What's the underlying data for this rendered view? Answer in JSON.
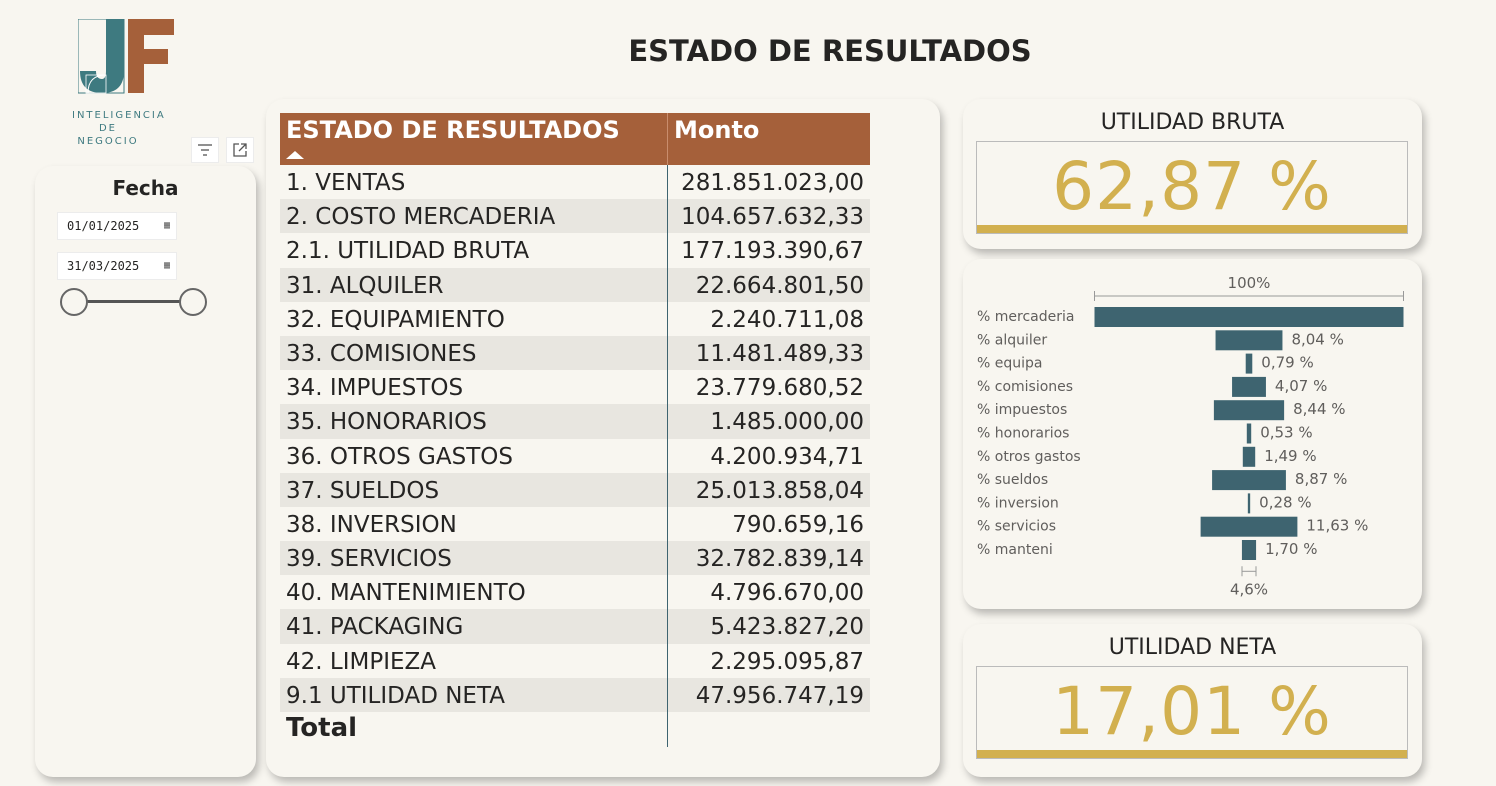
{
  "logo": {
    "letters": "JF",
    "line1": "INTELIGENCIA",
    "line2": "DE NEGOCIO",
    "colors": {
      "teal": "#3e7a80",
      "orange": "#a5603a"
    }
  },
  "page_title": "ESTADO DE RESULTADOS",
  "toolbar": {
    "filter_icon": "filter-icon",
    "focus_icon": "focus-mode-icon"
  },
  "slicer": {
    "title": "Fecha",
    "start_date": "01/01/2025",
    "end_date": "31/03/2025",
    "range": [
      0,
      1
    ]
  },
  "table": {
    "header": {
      "name": "ESTADO DE RESULTADOS",
      "value": "Monto"
    },
    "rows": [
      {
        "name": "1. VENTAS",
        "value": "281.851.023,00"
      },
      {
        "name": "2. COSTO MERCADERIA",
        "value": "104.657.632,33"
      },
      {
        "name": "2.1. UTILIDAD BRUTA",
        "value": "177.193.390,67"
      },
      {
        "name": "31. ALQUILER",
        "value": "22.664.801,50"
      },
      {
        "name": "32. EQUIPAMIENTO",
        "value": "2.240.711,08"
      },
      {
        "name": "33. COMISIONES",
        "value": "11.481.489,33"
      },
      {
        "name": "34. IMPUESTOS",
        "value": "23.779.680,52"
      },
      {
        "name": "35. HONORARIOS",
        "value": "1.485.000,00"
      },
      {
        "name": "36. OTROS GASTOS",
        "value": "4.200.934,71"
      },
      {
        "name": "37. SUELDOS",
        "value": "25.013.858,04"
      },
      {
        "name": "38. INVERSION",
        "value": "790.659,16"
      },
      {
        "name": "39. SERVICIOS",
        "value": "32.782.839,14"
      },
      {
        "name": "40. MANTENIMIENTO",
        "value": "4.796.670,00"
      },
      {
        "name": "41. PACKAGING",
        "value": "5.423.827,20"
      },
      {
        "name": "42. LIMPIEZA",
        "value": "2.295.095,87"
      },
      {
        "name": "9.1 UTILIDAD NETA",
        "value": "47.956.747,19"
      }
    ],
    "total_label": "Total"
  },
  "kpi_bruta": {
    "title": "UTILIDAD BRUTA",
    "value": "62,87 %",
    "color": "#d2b04f"
  },
  "kpi_neta": {
    "title": "UTILIDAD NETA",
    "value": "17,01 %",
    "color": "#d2b04f"
  },
  "chart_data": {
    "type": "bar",
    "orientation": "horizontal",
    "bar_color": "#3e6470",
    "top_bracket_label": "100%",
    "bottom_bracket_label": "4,6%",
    "categories": [
      "% mercaderia",
      "% alquiler",
      "% equipa",
      "% comisiones",
      "% impuestos",
      "% honorarios",
      "% otros gastos",
      "% sueldos",
      "% inversion",
      "% servicios",
      "% manteni"
    ],
    "values": [
      37.13,
      8.04,
      0.79,
      4.07,
      8.44,
      0.53,
      1.49,
      8.87,
      0.28,
      11.63,
      1.7
    ],
    "data_labels": [
      "",
      "8,04 %",
      "0,79 %",
      "4,07 %",
      "8,44 %",
      "0,53 %",
      "1,49 %",
      "8,87 %",
      "0,28 %",
      "11,63 %",
      "1,70 %"
    ]
  }
}
